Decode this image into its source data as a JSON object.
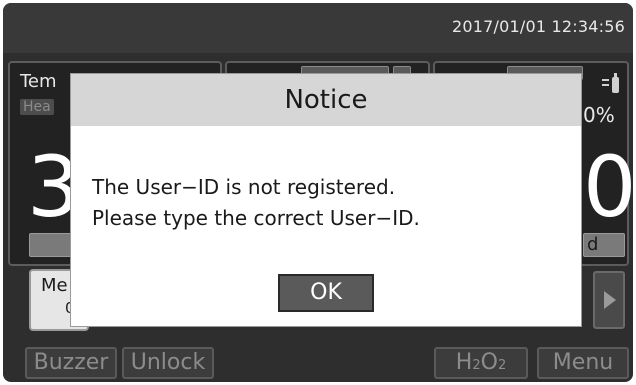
{
  "status_bar": {
    "datetime": "2017/01/01  12:34:56"
  },
  "panels": {
    "left": {
      "label": "Tem",
      "badge": "Hea",
      "big_value": "3"
    },
    "right": {
      "percent": "0%",
      "big_value": "0",
      "bar_text": "d",
      "icon": "gas-cylinder-icon"
    },
    "bottom_left": {
      "label": "Me",
      "sub": "0"
    }
  },
  "dialog": {
    "title": "Notice",
    "line1": "The User−ID is not registered.",
    "line2": "Please type the correct User−ID.",
    "ok_label": "OK"
  },
  "footer": {
    "buzzer_label": "Buzzer",
    "unlock_label": "Unlock",
    "h2o2_main": "H",
    "h2o2_sub1": "2",
    "h2o2_mid": "O",
    "h2o2_sub2": "2",
    "menu_label": "Menu"
  },
  "colors": {
    "screen_bg": "#2e2e2e",
    "dialog_header": "#d6d6d6",
    "ok_button": "#5a5a5a"
  }
}
